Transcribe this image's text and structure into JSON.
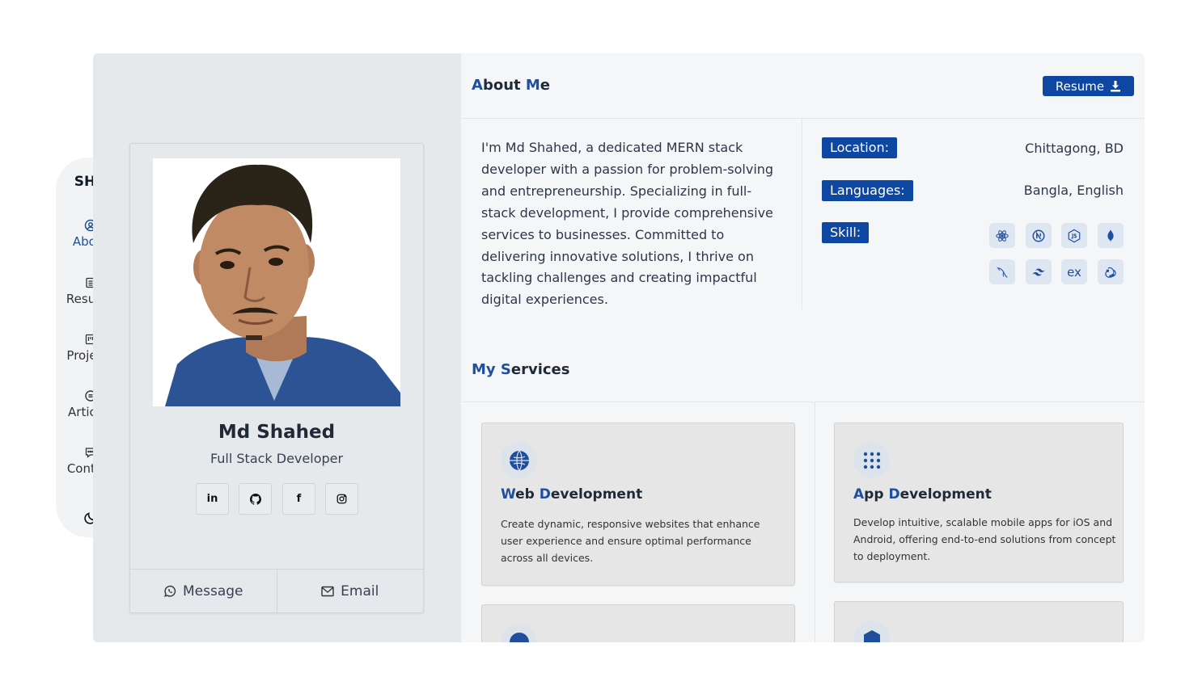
{
  "nav": {
    "brand": "SHD",
    "items": [
      {
        "label": "About",
        "icon": "user-circle-icon",
        "active": true
      },
      {
        "label": "Resume",
        "icon": "document-icon"
      },
      {
        "label": "Projects",
        "icon": "kanban-icon"
      },
      {
        "label": "Articles",
        "icon": "article-icon"
      },
      {
        "label": "Contact",
        "icon": "chat-icon"
      }
    ],
    "theme_toggle_icon": "moon-icon"
  },
  "profile": {
    "name": "Md Shahed",
    "role": "Full Stack Developer",
    "socials": [
      {
        "label": "in",
        "icon": "linkedin-icon"
      },
      {
        "label": "",
        "icon": "github-icon"
      },
      {
        "label": "f",
        "icon": "facebook-icon"
      },
      {
        "label": "",
        "icon": "instagram-icon"
      }
    ],
    "message_label": "Message",
    "email_label": "Email"
  },
  "about": {
    "title_first": "A",
    "title_rest": "bout ",
    "title_accent": "M",
    "title_end": "e",
    "resume_label": "Resume",
    "bio": "I'm Md Shahed, a dedicated MERN stack developer with a passion for problem-solving and entrepreneurship. Specializing in full-stack development, I provide comprehensive services to businesses. Committed to delivering innovative solutions, I thrive on tackling challenges and creating impactful digital experiences.",
    "location_label": "Location:",
    "location_value": "Chittagong, BD",
    "languages_label": "Languages:",
    "languages_value": "Bangla, English",
    "skill_label": "Skill:",
    "skills": [
      "react-icon",
      "nextjs-icon",
      "nodejs-icon",
      "mongodb-icon",
      "mysql-icon",
      "tailwind-icon",
      "express-icon",
      "redux-icon"
    ],
    "express_text": "ex"
  },
  "services": {
    "title_first": "My ",
    "title_accent": "S",
    "title_rest": "ervices",
    "items": [
      {
        "title_accent": "W",
        "title_a": "eb ",
        "title_accent2": "D",
        "title_b": "evelopment",
        "desc": "Create dynamic, responsive websites that enhance user experience and ensure optimal performance across all devices.",
        "icon": "globe-icon"
      },
      {
        "title_accent": "A",
        "title_a": "pp ",
        "title_accent2": "D",
        "title_b": "evelopment",
        "desc": "Develop intuitive, scalable mobile apps for iOS and Android, offering end-to-end solutions from concept to deployment.",
        "icon": "grid-icon"
      }
    ]
  },
  "colors": {
    "accent": "#0d47a1",
    "accent_text": "#1f4e9c"
  }
}
